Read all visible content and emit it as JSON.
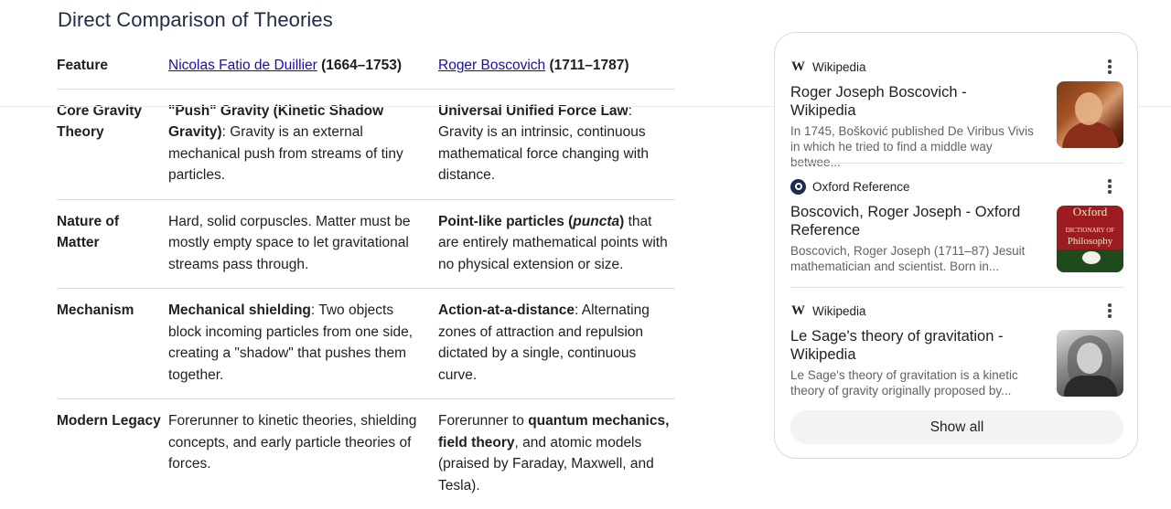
{
  "heading": "Direct Comparison of Theories",
  "table": {
    "header": {
      "feature": "Feature",
      "col1": {
        "link": "Nicolas Fatio de Duillier",
        "dates": "(1664–1753)"
      },
      "col2": {
        "link": "Roger Boscovich",
        "dates": "(1711–1787)"
      }
    },
    "rows": [
      {
        "feature": "Core Gravity Theory",
        "fatio": {
          "bold": "\"Push\" Gravity (Kinetic Shadow Gravity)",
          "rest": ": Gravity is an external mechanical push from streams of tiny particles."
        },
        "boscovich": {
          "bold": "Universal Unified Force Law",
          "rest": ": Gravity is an intrinsic, continuous mathematical force changing with distance."
        }
      },
      {
        "feature": "Nature of Matter",
        "fatio": {
          "text": "Hard, solid corpuscles. Matter must be mostly empty space to let gravitational streams pass through."
        },
        "boscovich": {
          "bold": "Point-like particles (",
          "italic": "puncta",
          "bold_end": ")",
          "rest": " that are entirely mathematical points with no physical extension or size."
        }
      },
      {
        "feature": "Mechanism",
        "fatio": {
          "bold": "Mechanical shielding",
          "rest": ": Two objects block incoming particles from one side, creating a \"shadow\" that pushes them together."
        },
        "boscovich": {
          "bold": "Action-at-a-distance",
          "rest": ": Alternating zones of attraction and repulsion dictated by a single, continuous curve."
        }
      },
      {
        "feature": "Modern Legacy",
        "fatio": {
          "text": "Forerunner to kinetic theories, shielding concepts, and early particle theories of forces."
        },
        "boscovich": {
          "pre": "Forerunner to ",
          "bold": "quantum mechanics, field theory",
          "rest": ", and atomic models (praised by Faraday, Maxwell, and Tesla)."
        }
      }
    ]
  },
  "sources": {
    "cards": [
      {
        "source_name": "Wikipedia",
        "icon": "wikipedia-w-icon",
        "title": "Roger Joseph Boscovich - Wikipedia",
        "snippet": "In 1745, Bošković published De Viribus Vivis in which he tried to find a middle way betwee..."
      },
      {
        "source_name": "Oxford Reference",
        "icon": "oxford-reference-icon",
        "title": "Boscovich, Roger Joseph - Oxford Reference",
        "snippet": "Boscovich, Roger Joseph (1711–87) Jesuit mathematician and scientist. Born in...",
        "thumb_text": {
          "line1": "Oxford",
          "line2": "DICTIONARY OF",
          "line3": "Philosophy"
        }
      },
      {
        "source_name": "Wikipedia",
        "icon": "wikipedia-w-icon",
        "title": "Le Sage's theory of gravitation - Wikipedia",
        "snippet": "Le Sage's theory of gravitation is a kinetic theory of gravity originally proposed by..."
      }
    ],
    "show_all": "Show all"
  }
}
